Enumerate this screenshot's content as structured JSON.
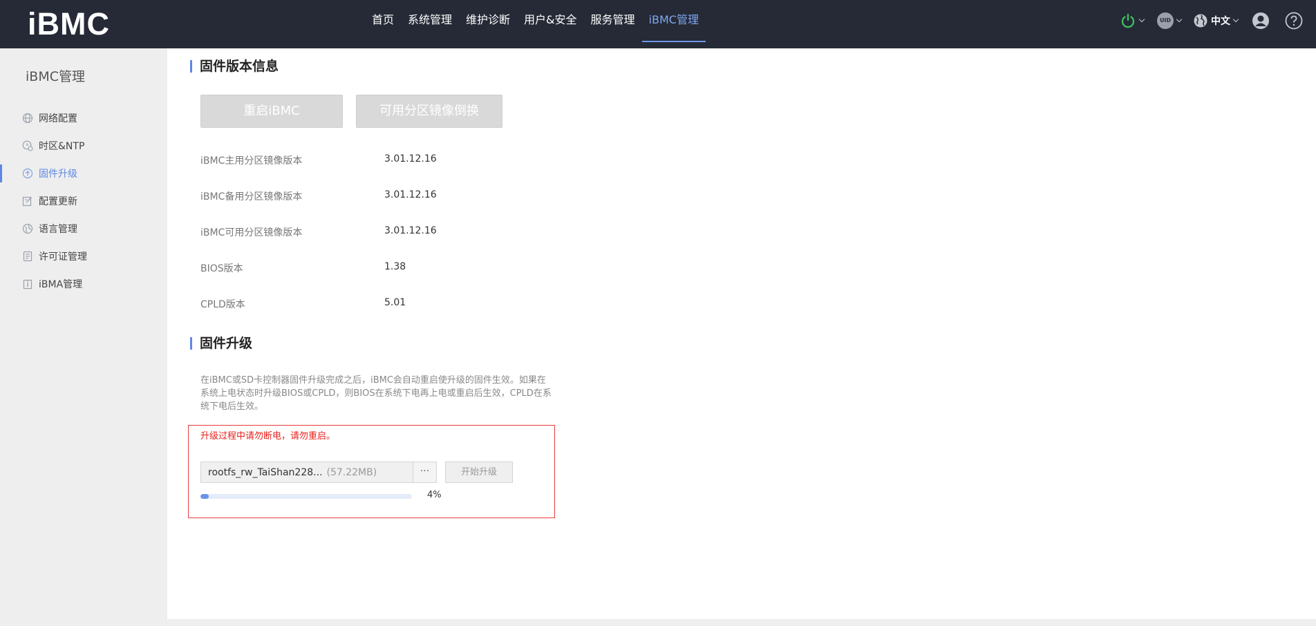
{
  "app": {
    "logo": "iBMC"
  },
  "nav": {
    "items": [
      {
        "label": "首页"
      },
      {
        "label": "系统管理"
      },
      {
        "label": "维护诊断"
      },
      {
        "label": "用户&安全"
      },
      {
        "label": "服务管理"
      },
      {
        "label": "iBMC管理",
        "active": true
      }
    ]
  },
  "toolbar": {
    "uid_label": "UID",
    "lang_label": "中文",
    "power_color": "#3dbb5e"
  },
  "sidebar": {
    "title": "iBMC管理",
    "items": [
      {
        "label": "网络配置",
        "icon": "globe-icon"
      },
      {
        "label": "时区&NTP",
        "icon": "clock-icon"
      },
      {
        "label": "固件升级",
        "icon": "upgrade-icon",
        "active": true
      },
      {
        "label": "配置更新",
        "icon": "config-edit-icon"
      },
      {
        "label": "语言管理",
        "icon": "language-icon"
      },
      {
        "label": "许可证管理",
        "icon": "license-icon"
      },
      {
        "label": "iBMA管理",
        "icon": "ibma-icon"
      }
    ]
  },
  "firmware_info": {
    "title": "固件版本信息",
    "restart_button": "重启iBMC",
    "switch_button": "可用分区镜像倒换",
    "rows": [
      {
        "label": "iBMC主用分区镜像版本",
        "value": "3.01.12.16"
      },
      {
        "label": "iBMC备用分区镜像版本",
        "value": "3.01.12.16"
      },
      {
        "label": "iBMC可用分区镜像版本",
        "value": "3.01.12.16"
      },
      {
        "label": "BIOS版本",
        "value": "1.38"
      },
      {
        "label": "CPLD版本",
        "value": "5.01"
      }
    ]
  },
  "upgrade": {
    "title": "固件升级",
    "description": "在iBMC或SD卡控制器固件升级完成之后，iBMC会自动重启使升级的固件生效。如果在系统上电状态时升级BIOS或CPLD，则BIOS在系统下电再上电或重启后生效，CPLD在系统下电后生效。",
    "warning": "升级过程中请勿断电，请勿重启。",
    "file_name": "rootfs_rw_TaiShan228...",
    "file_size": "(57.22MB)",
    "browse_label": "···",
    "start_button": "开始升级",
    "progress_percent": 4,
    "progress_label": "4%",
    "accent_color": "#6c93ea",
    "warning_color": "#e8201d"
  }
}
